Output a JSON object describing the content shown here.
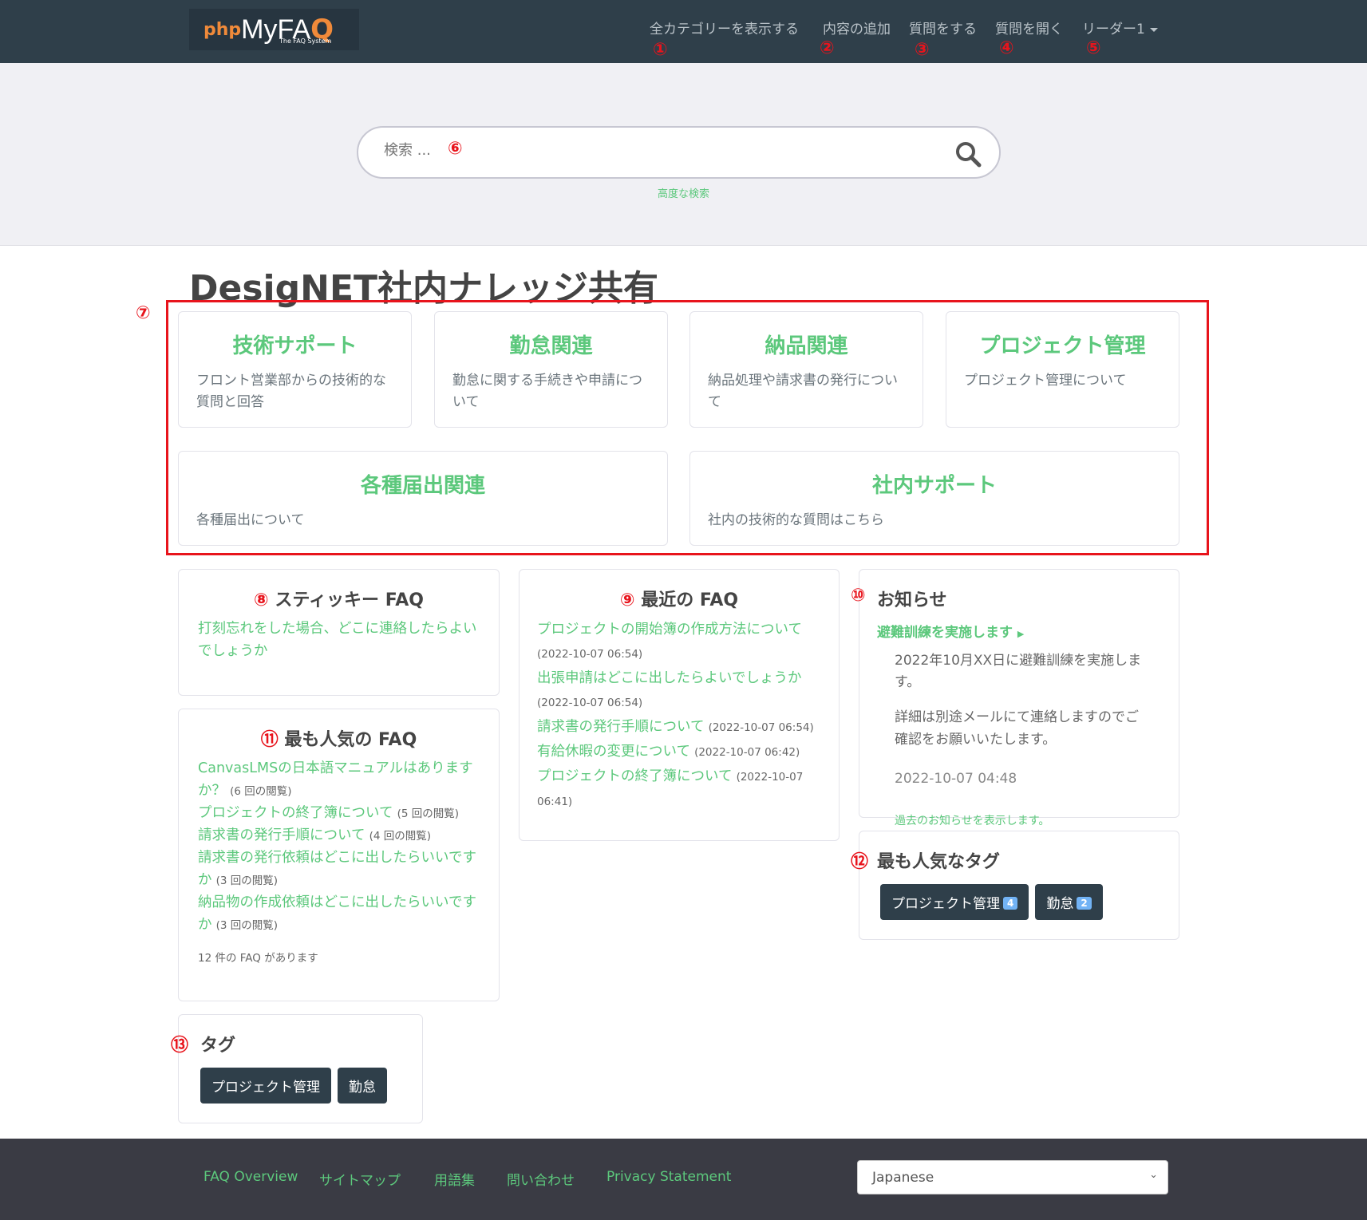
{
  "header": {
    "logo_text": {
      "php": "php",
      "my": "MyFA",
      "q": "Q",
      "sub": "The FAQ System"
    },
    "nav": [
      {
        "label": "全カテゴリーを表示する",
        "mark": "①"
      },
      {
        "label": "内容の追加",
        "mark": "②"
      },
      {
        "label": "質問をする",
        "mark": "③"
      },
      {
        "label": "質問を開く",
        "mark": "④"
      },
      {
        "label": "リーダー1",
        "mark": "⑤"
      }
    ]
  },
  "search": {
    "placeholder": "検索 ...",
    "mark": "⑥",
    "advanced": "高度な検索"
  },
  "page_title": "DesigNET社内ナレッジ共有",
  "categories": {
    "mark": "⑦",
    "items": [
      {
        "title": "技術サポート",
        "desc": "フロント営業部からの技術的な質問と回答"
      },
      {
        "title": "勤怠関連",
        "desc": "勤怠に関する手続きや申請について"
      },
      {
        "title": "納品関連",
        "desc": "納品処理や請求書の発行について"
      },
      {
        "title": "プロジェクト管理",
        "desc": "プロジェクト管理について"
      },
      {
        "title": "各種届出関連",
        "desc": "各種届出について"
      },
      {
        "title": "社内サポート",
        "desc": "社内の技術的な質問はこちら"
      }
    ]
  },
  "sticky": {
    "mark": "⑧",
    "title": "スティッキー FAQ",
    "items": [
      "打刻忘れをした場合、どこに連絡したらよいでしょうか"
    ]
  },
  "popular": {
    "mark": "⑪",
    "title": "最も人気の FAQ",
    "items": [
      {
        "q": "CanvasLMSの日本語マニュアルはありますか？",
        "views": "(6 回の閲覧)"
      },
      {
        "q": "プロジェクトの終了簿について",
        "views": "(5 回の閲覧)"
      },
      {
        "q": "請求書の発行手順について",
        "views": "(4 回の閲覧)"
      },
      {
        "q": "請求書の発行依頼はどこに出したらいいですか",
        "views": "(3 回の閲覧)"
      },
      {
        "q": "納品物の作成依頼はどこに出したらいいですか",
        "views": "(3 回の閲覧)"
      }
    ],
    "total": "12 件の FAQ があります"
  },
  "tags": {
    "mark": "⑬",
    "title": "タグ",
    "items": [
      "プロジェクト管理",
      "勤怠"
    ]
  },
  "recent": {
    "mark": "⑨",
    "title": "最近の FAQ",
    "items": [
      {
        "q": "プロジェクトの開始簿の作成方法について",
        "date": "(2022-10-07 06:54)"
      },
      {
        "q": "出張申請はどこに出したらよいでしょうか",
        "date": "(2022-10-07 06:54)"
      },
      {
        "q": "請求書の発行手順について",
        "date": "(2022-10-07 06:54)"
      },
      {
        "q": "有給休暇の変更について",
        "date": "(2022-10-07 06:42)"
      },
      {
        "q": "プロジェクトの終了簿について",
        "date": "(2022-10-07 06:41)"
      }
    ]
  },
  "news": {
    "mark": "⑩",
    "title": "お知らせ",
    "headline": "避難訓練を実施します",
    "body1": "2022年10月XX日に避難訓練を実施します。",
    "body2": "詳細は別途メールにて連絡しますのでご確認をお願いいたします。",
    "date": "2022-10-07 04:48",
    "archive": "過去のお知らせを表示します。"
  },
  "popular_tags": {
    "mark": "⑫",
    "title": "最も人気なタグ",
    "items": [
      {
        "label": "プロジェクト管理",
        "count": "4"
      },
      {
        "label": "勤怠",
        "count": "2"
      }
    ]
  },
  "footer": {
    "links": [
      "FAQ Overview",
      "サイトマップ",
      "用語集",
      "問い合わせ",
      "Privacy Statement"
    ],
    "language": "Japanese"
  },
  "colors": {
    "header": "#2f3f4a",
    "accent": "#5cc87c",
    "annotation": "#e8141c",
    "footer": "#3a3b44"
  }
}
